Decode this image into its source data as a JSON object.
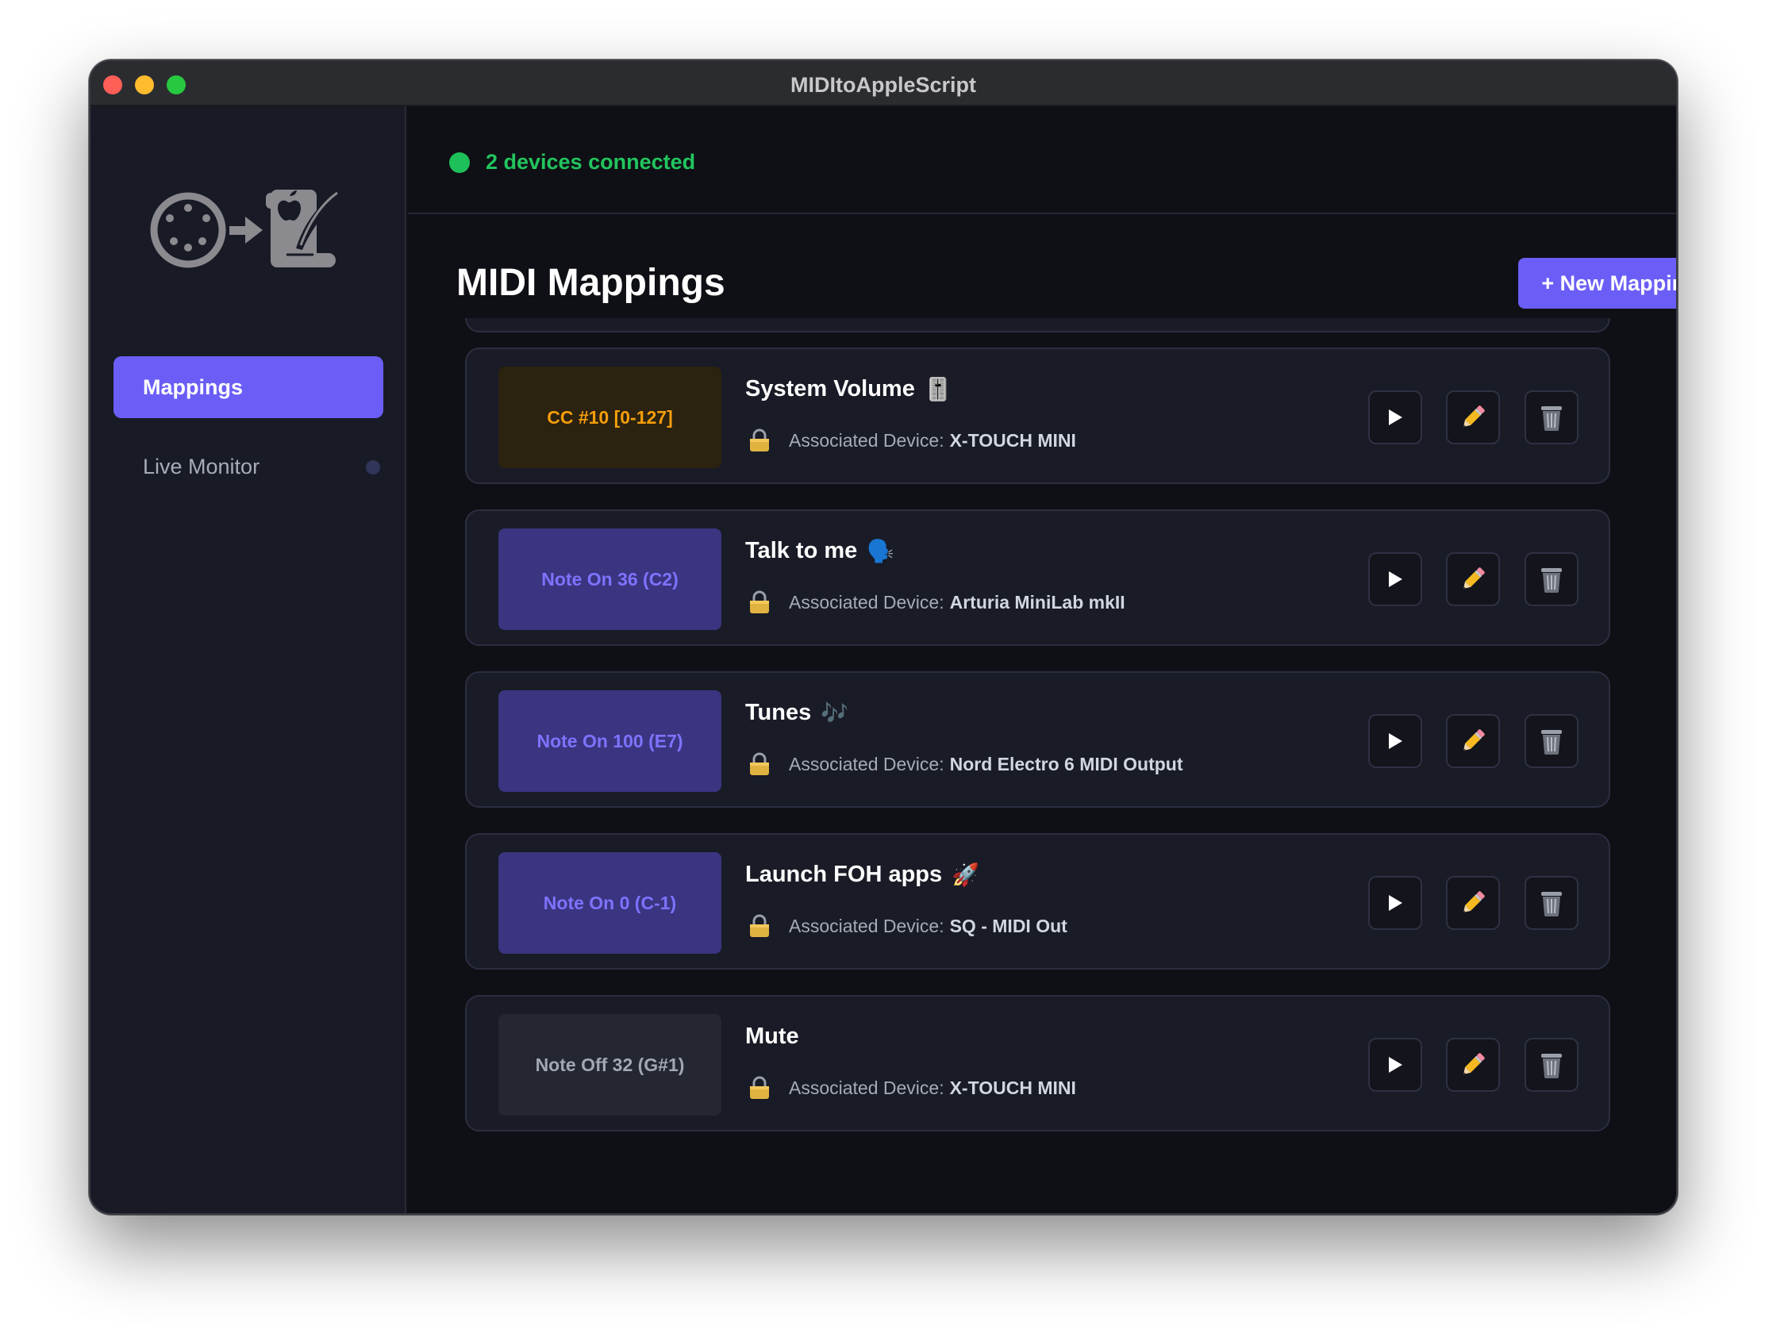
{
  "window": {
    "title": "MIDItoAppleScript"
  },
  "sidebar": {
    "items": [
      {
        "label": "Mappings",
        "active": true
      },
      {
        "label": "Live Monitor",
        "active": false
      }
    ]
  },
  "status": {
    "text": "2 devices connected",
    "color": "#22c55e"
  },
  "main": {
    "heading": "MIDI Mappings",
    "new_button_label": "+ New Mapping"
  },
  "device_prefix": "Associated Device:",
  "mappings": [
    {
      "trigger": "CC #10 [0-127]",
      "trigger_type": "cc",
      "name": "System Volume",
      "emoji": "🎚️",
      "device": "X-TOUCH MINI"
    },
    {
      "trigger": "Note On 36 (C2)",
      "trigger_type": "note_on",
      "name": "Talk to me",
      "emoji": "🗣️",
      "device": "Arturia MiniLab mkII"
    },
    {
      "trigger": "Note On 100 (E7)",
      "trigger_type": "note_on",
      "name": "Tunes",
      "emoji": "🎶",
      "device": "Nord Electro 6 MIDI Output"
    },
    {
      "trigger": "Note On 0 (C-1)",
      "trigger_type": "note_on",
      "name": "Launch FOH apps",
      "emoji": "🚀",
      "device": "SQ - MIDI Out"
    },
    {
      "trigger": "Note Off 32 (G#1)",
      "trigger_type": "note_off",
      "name": "Mute",
      "emoji": "",
      "device": "X-TOUCH MINI"
    }
  ],
  "icons": {
    "play": "play-icon",
    "edit": "pencil-icon",
    "delete": "trash-icon",
    "lock": "lock-icon"
  },
  "colors": {
    "accent": "#6b5ef6",
    "cc_chip_text": "#f59e0b",
    "note_on_chip_text": "#7e73ff",
    "note_off_chip_text": "#a3a7b3"
  }
}
